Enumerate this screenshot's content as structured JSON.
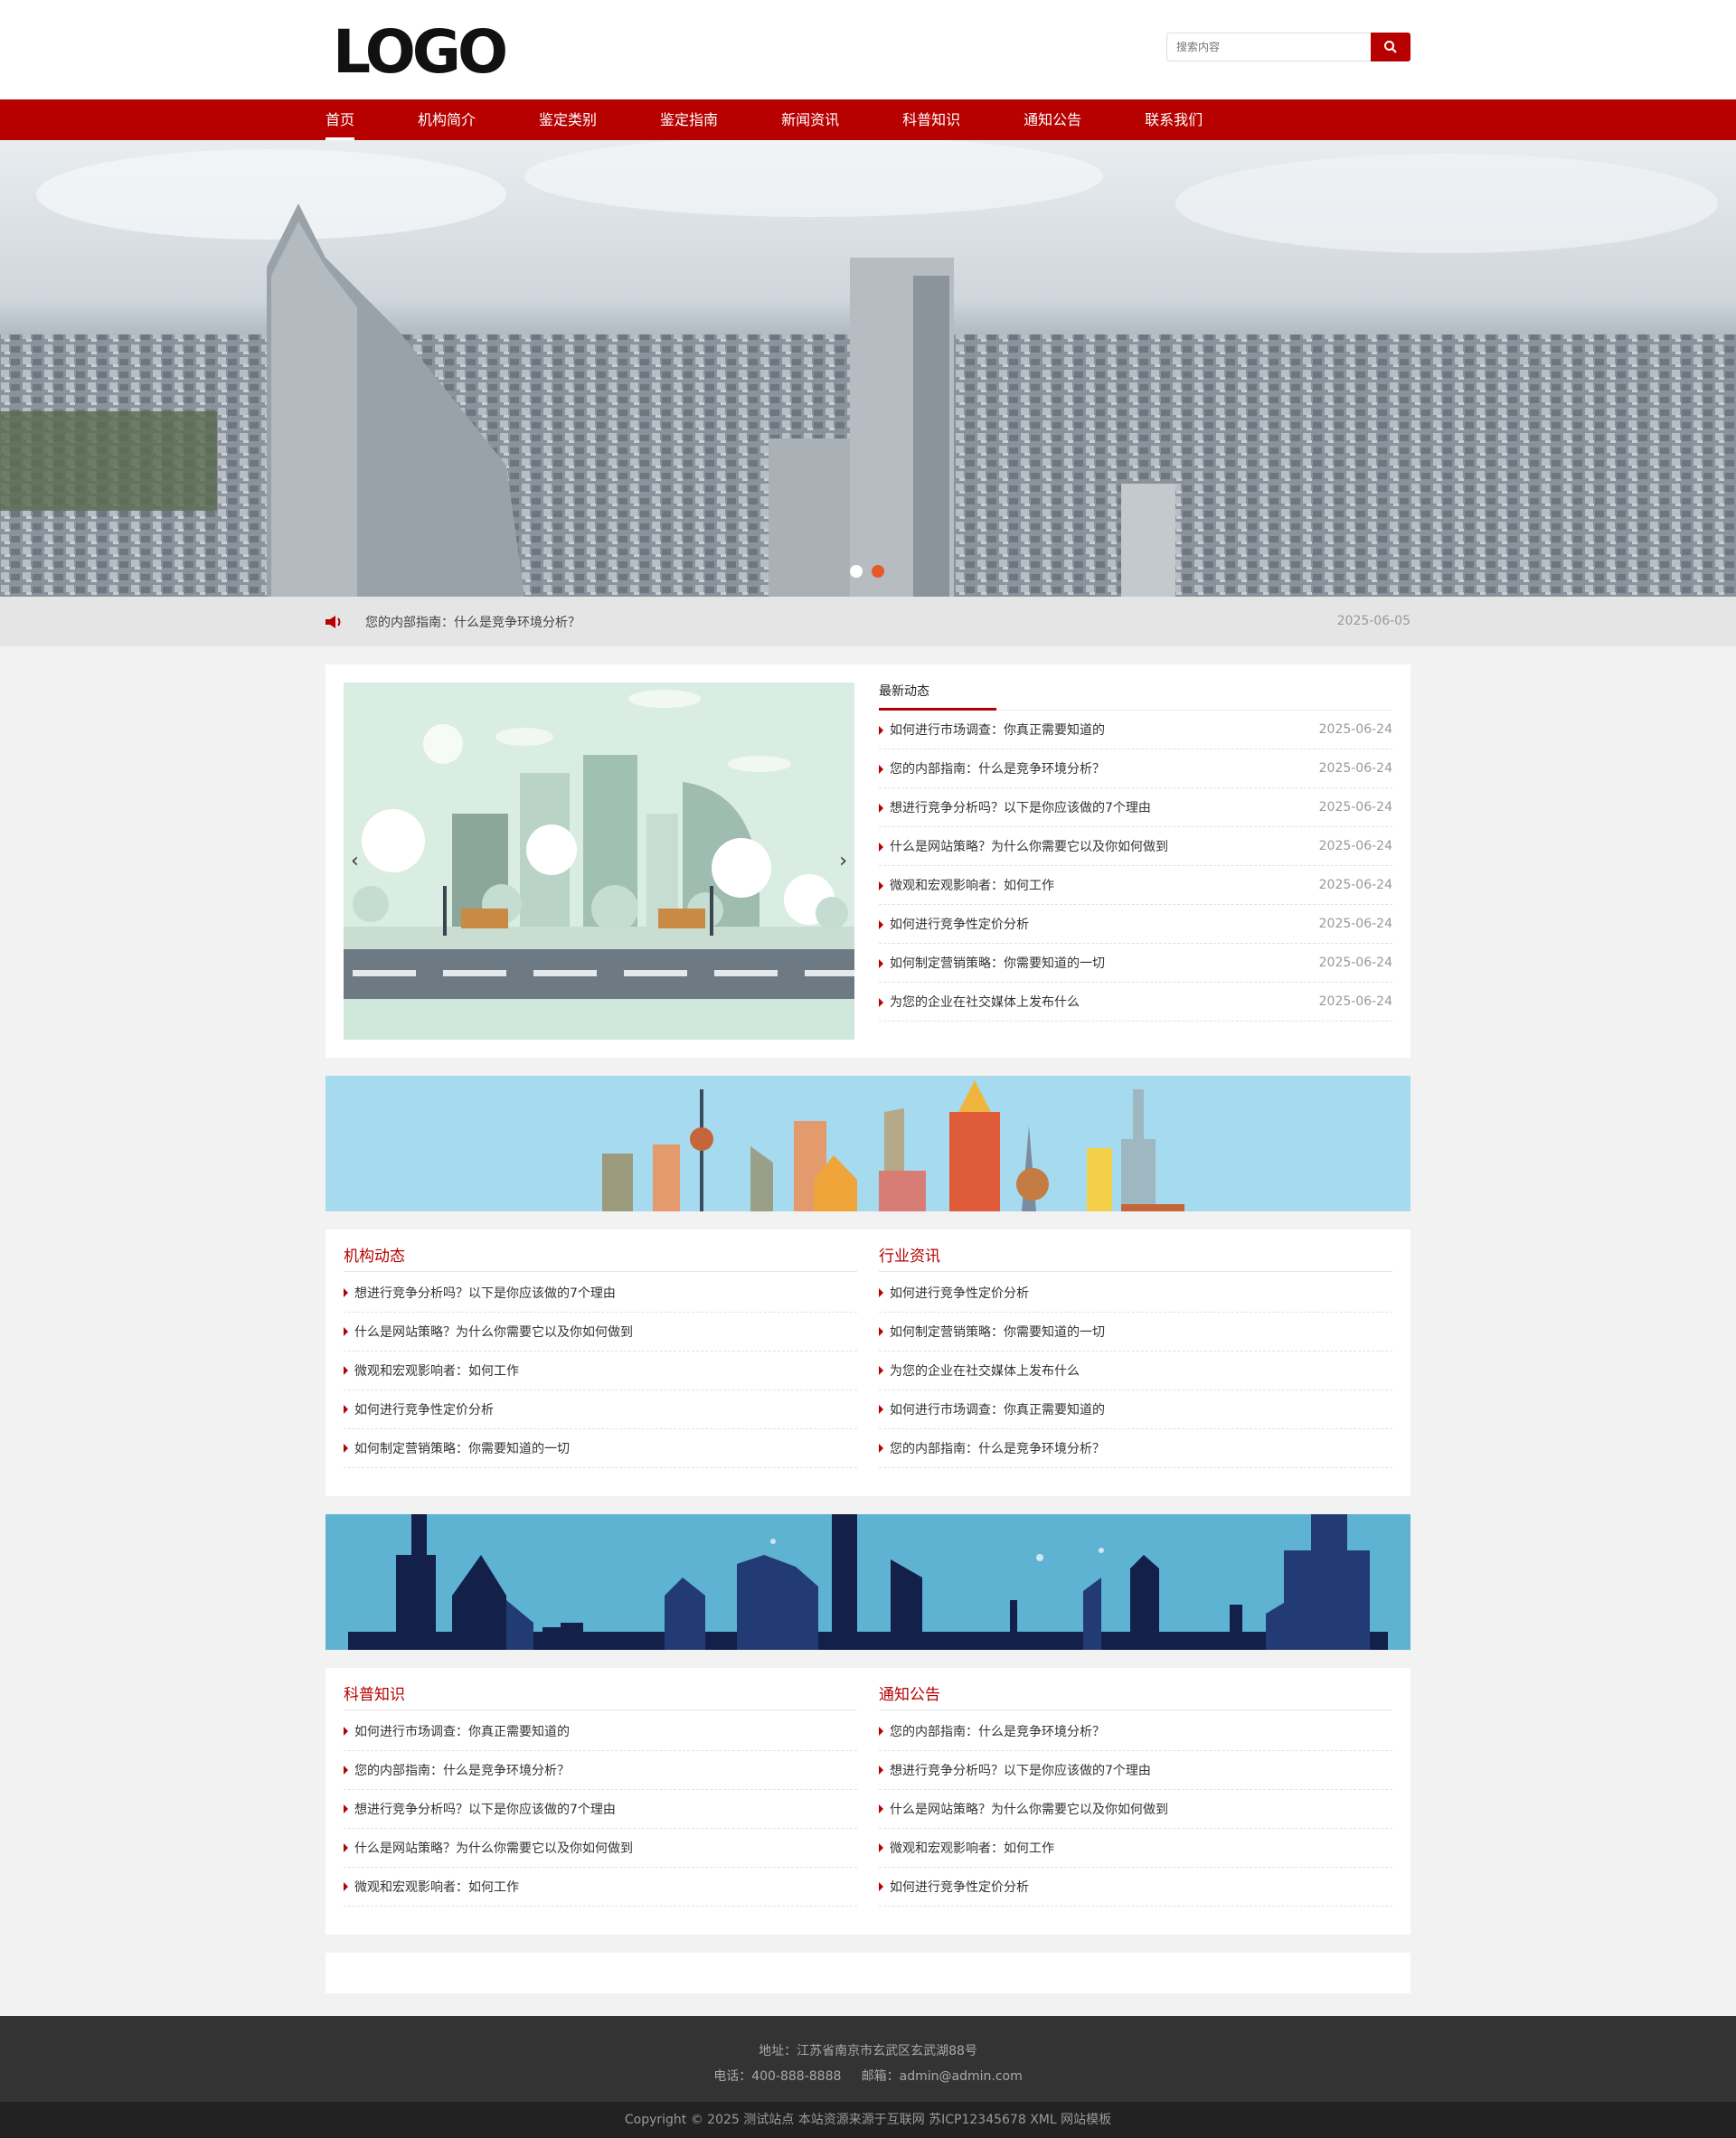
{
  "header": {
    "logo_text": "LOGO",
    "search_placeholder": "搜索内容"
  },
  "nav": {
    "items": [
      "首页",
      "机构简介",
      "鉴定类别",
      "鉴定指南",
      "新闻资讯",
      "科普知识",
      "通知公告",
      "联系我们"
    ],
    "active_index": 0
  },
  "banner": {
    "slides": 2,
    "active_slide": 1
  },
  "notice": {
    "text": "您的内部指南：什么是竞争环境分析？",
    "date": "2025-06-05"
  },
  "latest": {
    "title": "最新动态",
    "items": [
      {
        "title": "如何进行市场调查：你真正需要知道的",
        "date": "2025-06-24"
      },
      {
        "title": "您的内部指南：什么是竞争环境分析？",
        "date": "2025-06-24"
      },
      {
        "title": "想进行竞争分析吗？以下是你应该做的7个理由",
        "date": "2025-06-24"
      },
      {
        "title": "什么是网站策略？为什么你需要它以及你如何做到",
        "date": "2025-06-24"
      },
      {
        "title": "微观和宏观影响者：如何工作",
        "date": "2025-06-24"
      },
      {
        "title": "如何进行竞争性定价分析",
        "date": "2025-06-24"
      },
      {
        "title": "如何制定营销策略：你需要知道的一切",
        "date": "2025-06-24"
      },
      {
        "title": "为您的企业在社交媒体上发布什么",
        "date": "2025-06-24"
      }
    ]
  },
  "org_news": {
    "title": "机构动态",
    "items": [
      "想进行竞争分析吗？以下是你应该做的7个理由",
      "什么是网站策略？为什么你需要它以及你如何做到",
      "微观和宏观影响者：如何工作",
      "如何进行竞争性定价分析",
      "如何制定营销策略：你需要知道的一切"
    ]
  },
  "industry_news": {
    "title": "行业资讯",
    "items": [
      "如何进行竞争性定价分析",
      "如何制定营销策略：你需要知道的一切",
      "为您的企业在社交媒体上发布什么",
      "如何进行市场调查：你真正需要知道的",
      "您的内部指南：什么是竞争环境分析？"
    ]
  },
  "science": {
    "title": "科普知识",
    "items": [
      "如何进行市场调查：你真正需要知道的",
      "您的内部指南：什么是竞争环境分析？",
      "想进行竞争分析吗？以下是你应该做的7个理由",
      "什么是网站策略？为什么你需要它以及你如何做到",
      "微观和宏观影响者：如何工作"
    ]
  },
  "announcements": {
    "title": "通知公告",
    "items": [
      "您的内部指南：什么是竞争环境分析？",
      "想进行竞争分析吗？以下是你应该做的7个理由",
      "什么是网站策略？为什么你需要它以及你如何做到",
      "微观和宏观影响者：如何工作",
      "如何进行竞争性定价分析"
    ]
  },
  "footer": {
    "address": "地址：江苏省南京市玄武区玄武湖88号",
    "phone": "电话：400-888-8888",
    "email": "邮箱：admin@admin.com",
    "copyright": "Copyright © 2025 测试站点 本站资源来源于互联网 苏ICP12345678 XML 网站模板"
  },
  "colors": {
    "brand": "#b70000",
    "background": "#f2f2f2",
    "footer": "#333333",
    "slider_dot_active": "#e65a2a"
  }
}
